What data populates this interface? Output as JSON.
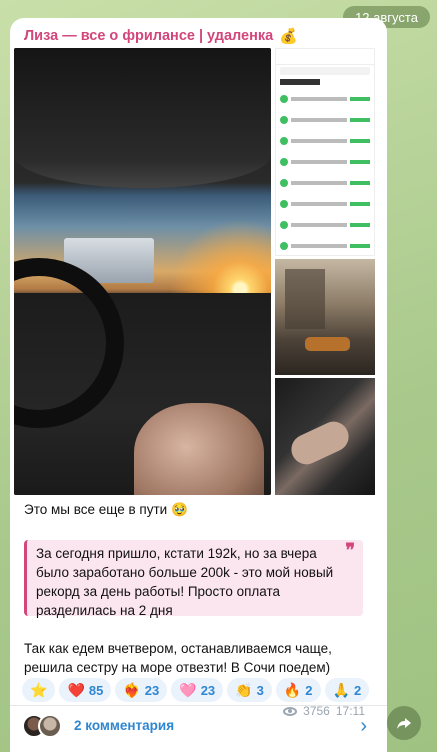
{
  "date_pill": "12 августа",
  "channel": {
    "name": "Лиза — все о фрилансе | удаленка",
    "emoji": "💰"
  },
  "message": {
    "text_1": "Это мы все еще в пути",
    "text_1_emoji": "🥹",
    "quote": "За сегодня пришло, кстати 192k, но за вчера было заработано больше 200k - это мой новый рекорд за день работы! Просто оплата разделилась на 2 дня",
    "quote_mark": "❞",
    "text_2": "Так как едем вчетвером, останавливаемся чаще, решила сестру на море отвезти! В Сочи поедем)"
  },
  "reactions": [
    {
      "icon": "⭐",
      "name": "star",
      "count": ""
    },
    {
      "icon": "❤️",
      "name": "red-heart",
      "count": "85"
    },
    {
      "icon": "❤️‍🔥",
      "name": "heart-on-fire",
      "count": "23"
    },
    {
      "icon": "🩷",
      "name": "pink-heart",
      "count": "23"
    },
    {
      "icon": "👏",
      "name": "clapping-hands",
      "count": "3"
    },
    {
      "icon": "🔥",
      "name": "fire",
      "count": "2"
    },
    {
      "icon": "🙏",
      "name": "folded-hands",
      "count": "2"
    }
  ],
  "meta": {
    "views": "3756",
    "time": "17:11"
  },
  "comments": {
    "label": "2 комментария"
  },
  "colors": {
    "accent": "#d2467b",
    "link": "#2f86d1",
    "quote_bg": "#fbe5ee"
  }
}
